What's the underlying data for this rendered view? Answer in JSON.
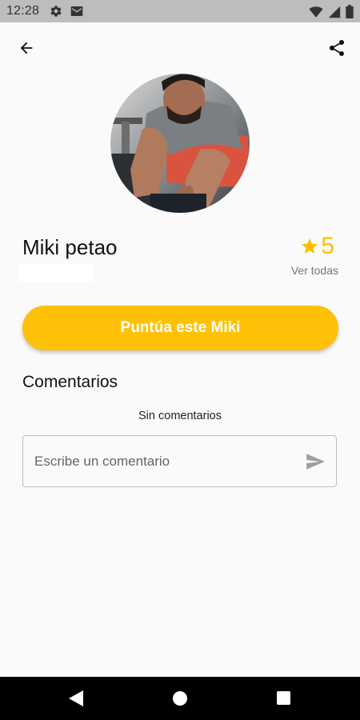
{
  "status_bar": {
    "time": "12:28",
    "icons": [
      "settings-icon",
      "mail-icon",
      "wifi-icon",
      "signal-icon",
      "battery-icon"
    ]
  },
  "app_bar": {
    "back_icon": "arrow-back-icon",
    "share_icon": "share-icon"
  },
  "profile": {
    "name": "Miki petao",
    "avatar": "man-training-photo",
    "rating": {
      "star_icon": "star-icon",
      "value": "5",
      "see_all_label": "Ver todas"
    }
  },
  "rate_button": {
    "label": "Puntúa este Miki"
  },
  "comments": {
    "heading": "Comentarios",
    "empty_text": "Sin comentarios",
    "input": {
      "placeholder": "Escribe un comentario",
      "value": ""
    },
    "send_icon": "send-icon"
  },
  "colors": {
    "accent": "#ffc107",
    "rating": "#ffbf00",
    "background": "#fafafa",
    "status_bar": "#bdbdbd",
    "nav_bar": "#000000"
  },
  "nav_bar": {
    "icons": [
      "nav-back-icon",
      "nav-home-icon",
      "nav-recents-icon"
    ]
  }
}
